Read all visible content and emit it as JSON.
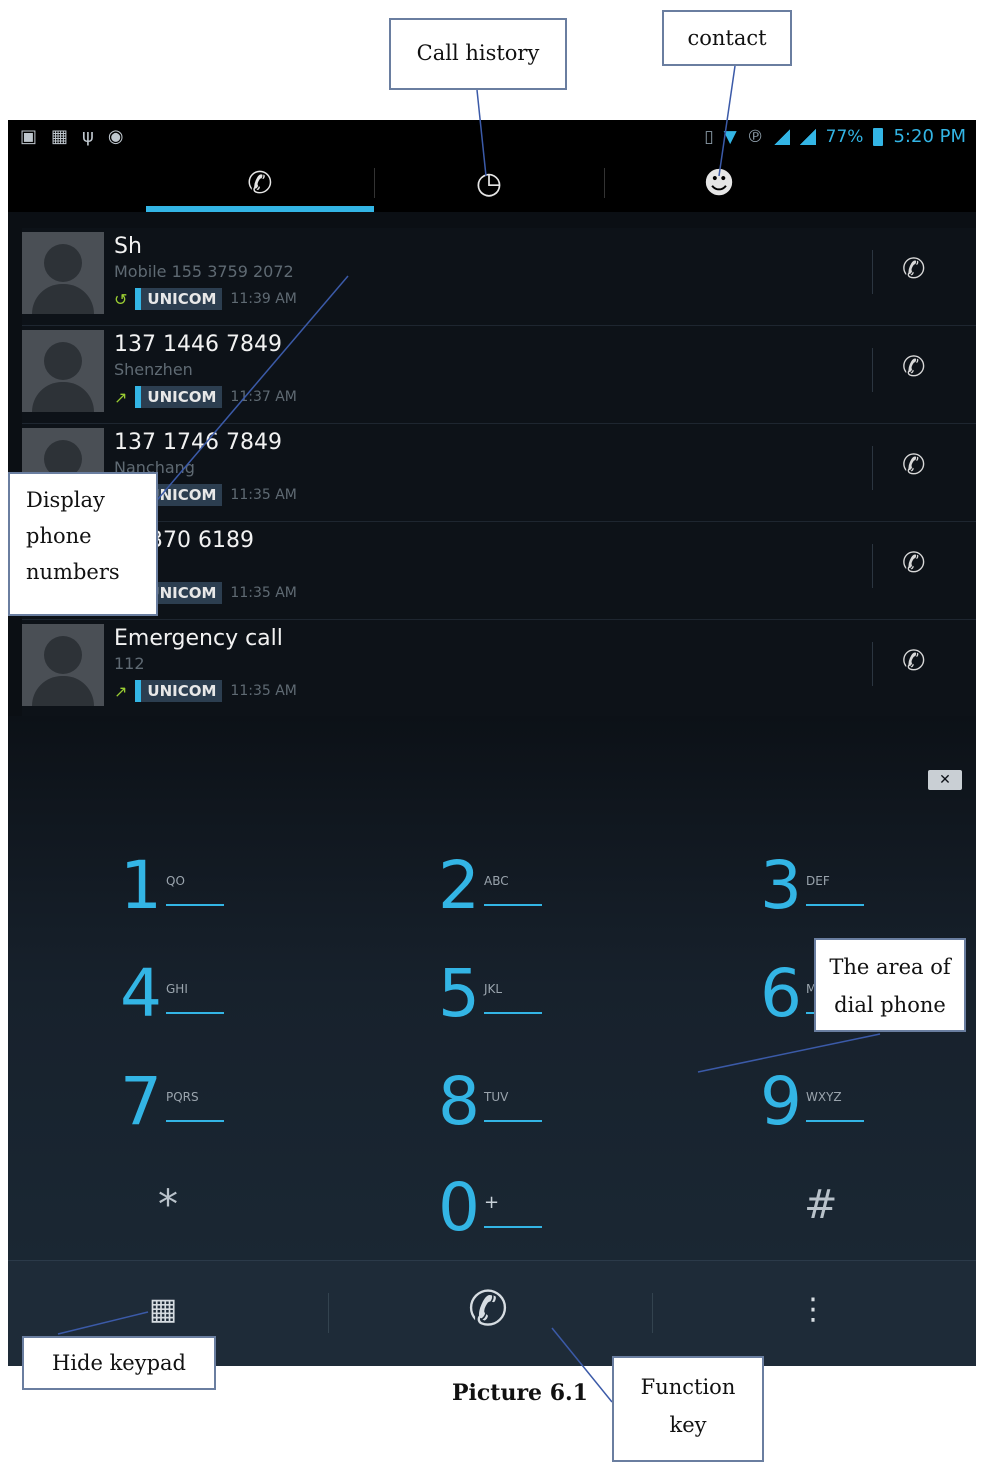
{
  "status_bar": {
    "left_icons": [
      "screenshot-icon",
      "image-icon",
      "usb-icon",
      "android-debug-icon"
    ],
    "battery": "77%",
    "time": "5:20 PM"
  },
  "tabs": [
    {
      "icon": "phone-icon",
      "selected": true
    },
    {
      "icon": "clock-icon",
      "selected": false
    },
    {
      "icon": "contact-icon",
      "selected": false
    }
  ],
  "calls": [
    {
      "name": "Sh",
      "sub": "Mobile 155 3759 2072",
      "carrier": "UNICOM",
      "time": "11:39 AM",
      "type_icon": "↺"
    },
    {
      "name": "137 1446 7849",
      "sub": "Shenzhen",
      "carrier": "UNICOM",
      "time": "11:37 AM",
      "type_icon": "↗"
    },
    {
      "name": "137 1746 7849",
      "sub": "Nanchang",
      "carrier": "UNICOM",
      "time": "11:35 AM",
      "type_icon": "↗"
    },
    {
      "name": "5 2370 6189",
      "sub": "n",
      "carrier": "UNICOM",
      "time": "11:35 AM",
      "type_icon": "↗"
    },
    {
      "name": "Emergency call",
      "sub": "112",
      "carrier": "UNICOM",
      "time": "11:35 AM",
      "type_icon": "↗"
    }
  ],
  "keypad": [
    {
      "digit": "1",
      "letters": "QO"
    },
    {
      "digit": "2",
      "letters": "ABC"
    },
    {
      "digit": "3",
      "letters": "DEF"
    },
    {
      "digit": "4",
      "letters": "GHI"
    },
    {
      "digit": "5",
      "letters": "JKL"
    },
    {
      "digit": "6",
      "letters": "MNO"
    },
    {
      "digit": "7",
      "letters": "PQRS"
    },
    {
      "digit": "8",
      "letters": "TUV"
    },
    {
      "digit": "9",
      "letters": "WXYZ"
    },
    {
      "digit": "*",
      "letters": ""
    },
    {
      "digit": "0",
      "letters": "+"
    },
    {
      "digit": "#",
      "letters": ""
    }
  ],
  "annotations": {
    "call_history": "Call history",
    "contact": "contact",
    "display_numbers": "Display phone numbers",
    "dial_area": "The area of dial phone",
    "hide_keypad": "Hide keypad",
    "function_key": "Function key"
  },
  "caption": "Picture 6.1",
  "colors": {
    "accent": "#33b5e5",
    "background": "#0b0f14"
  }
}
